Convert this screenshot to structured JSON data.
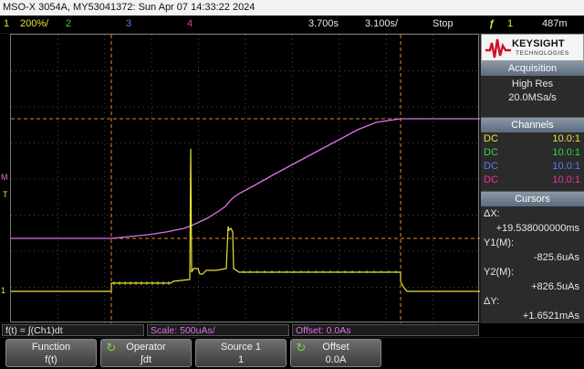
{
  "title_bar": "MSO-X 3054A, MY53041372: Sun Apr 07 14:33:22 2024",
  "top_bar": {
    "ch1_num": "1",
    "ch1_scale": "200%/",
    "ch2_num": "2",
    "ch3_num": "3",
    "ch4_num": "4",
    "trig_pos": "3.700s",
    "time_scale": "3.100s/",
    "run_state": "Stop",
    "trig_icon": "trigger-edge-icon",
    "trig_src": "1",
    "trig_level": "487m"
  },
  "colors": {
    "ch1": "#e8e23a",
    "ch2": "#38d638",
    "ch3": "#5a78f0",
    "ch4": "#f0309a",
    "math": "#e070e8",
    "cursor": "#e08a2c",
    "grid": "#4a4a4a"
  },
  "screen_markers": {
    "trigger_level": "T",
    "ch1_ground": "1",
    "math_ground": "M"
  },
  "logo": {
    "brand": "KEYSIGHT",
    "sub": "TECHNOLOGIES"
  },
  "acquisition": {
    "header": "Acquisition",
    "mode": "High Res",
    "rate": "20.0MSa/s"
  },
  "channels": {
    "header": "Channels",
    "rows": [
      {
        "coupling": "DC",
        "probe": "10.0:1",
        "color": "#e8e23a"
      },
      {
        "coupling": "DC",
        "probe": "10.0:1",
        "color": "#38d638"
      },
      {
        "coupling": "DC",
        "probe": "10.0:1",
        "color": "#5a78f0"
      },
      {
        "coupling": "DC",
        "probe": "10.0:1",
        "color": "#f0309a"
      }
    ]
  },
  "cursors": {
    "header": "Cursors",
    "dx_label": "ΔX:",
    "dx_value": "+19.538000000ms",
    "y1_label": "Y1(M):",
    "y1_value": "-825.6uAs",
    "y2_label": "Y2(M):",
    "y2_value": "+826.5uAs",
    "dy_label": "ΔY:",
    "dy_value": "+1.6521mAs"
  },
  "function_bar": {
    "expr": "f(t) = ∫(Ch1)dt",
    "scale": "Scale: 500uAs/",
    "offset": "Offset: 0.0As"
  },
  "softkeys": [
    {
      "title": "Function",
      "value": "f(t)"
    },
    {
      "title": "Operator",
      "value": "∫dt",
      "icon": "rotate-knob-icon"
    },
    {
      "title": "Source 1",
      "value": "1"
    },
    {
      "title": "Offset",
      "value": "0.0A",
      "icon": "rotate-knob-icon"
    }
  ]
}
